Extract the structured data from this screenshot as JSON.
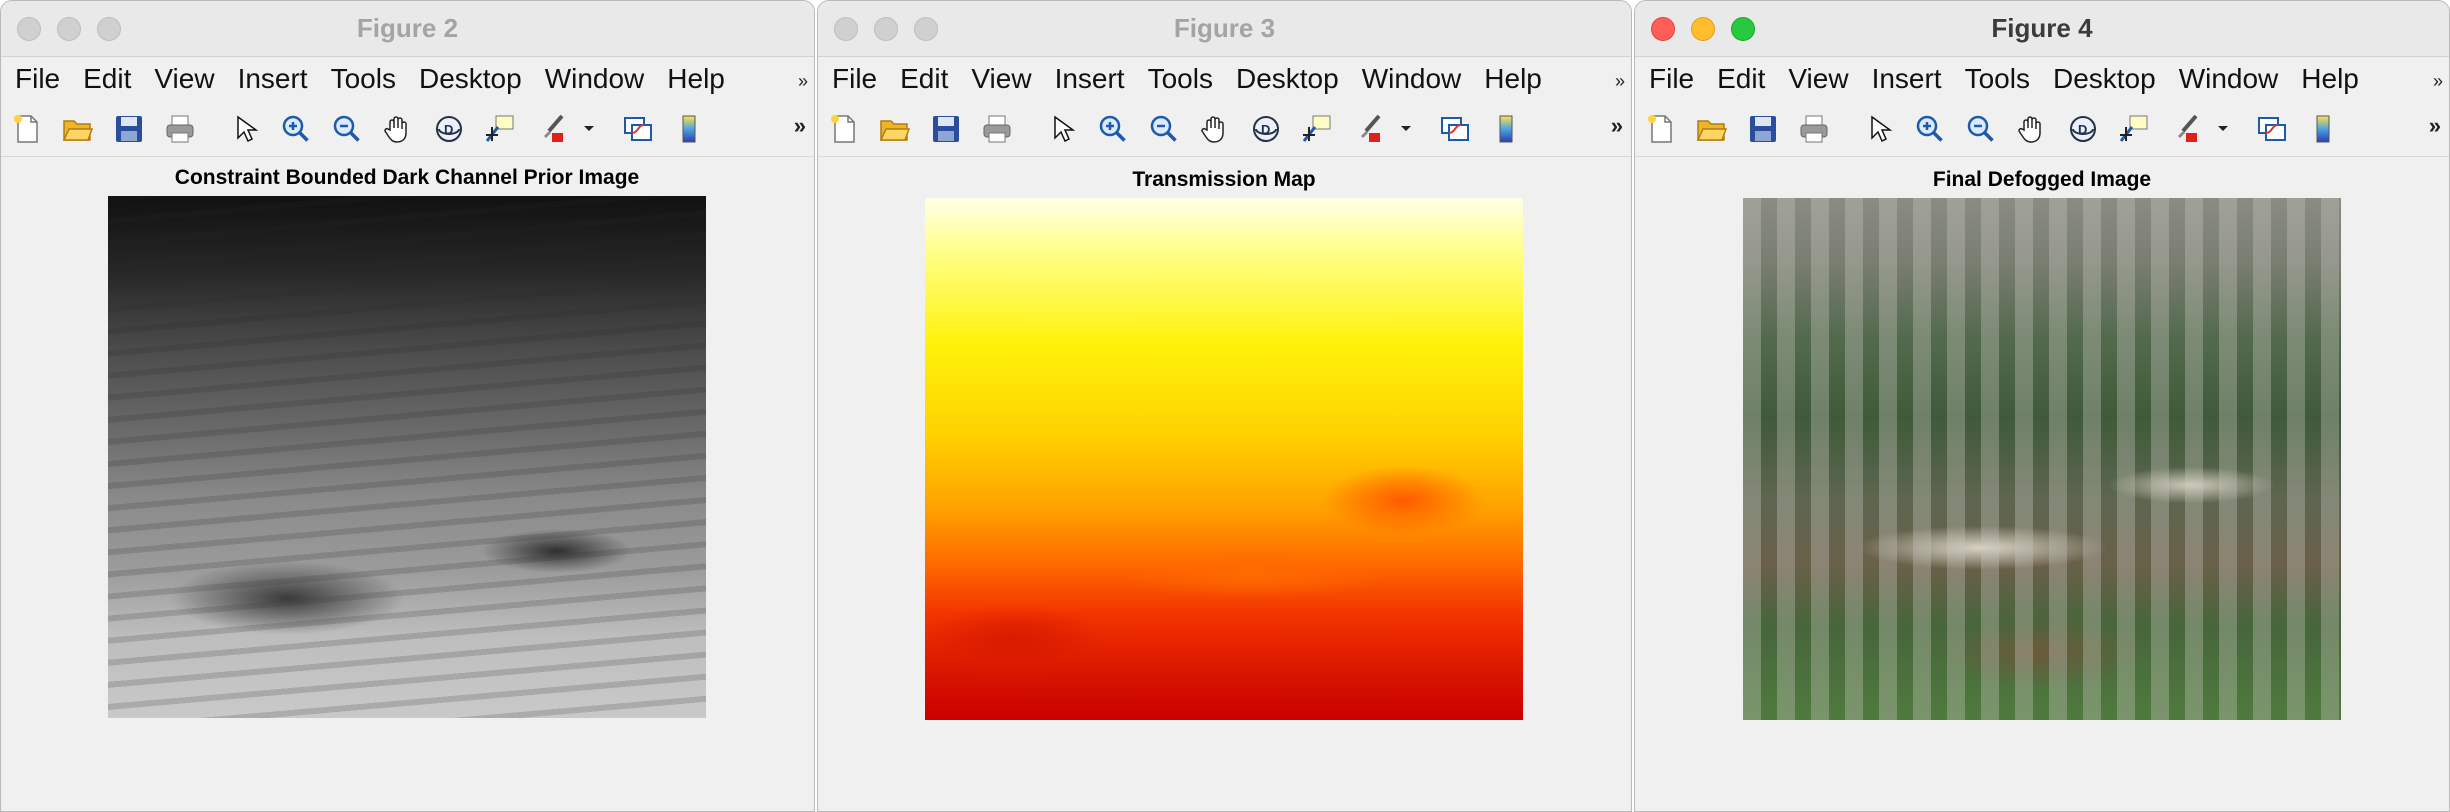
{
  "menu_labels": [
    "File",
    "Edit",
    "View",
    "Insert",
    "Tools",
    "Desktop",
    "Window",
    "Help"
  ],
  "toolbar_icons": [
    "new-figure-icon",
    "open-folder-icon",
    "save-icon",
    "print-icon",
    "pointer-icon",
    "zoom-in-icon",
    "zoom-out-icon",
    "pan-hand-icon",
    "rotate-3d-icon",
    "data-cursor-icon",
    "brush-icon",
    "link-plot-icon",
    "colorbar-icon"
  ],
  "overflow_menu_glyph": "»",
  "overflow_toolbar_glyph": "»",
  "windows": [
    {
      "title": "Figure 2",
      "active": false,
      "axes_title": "Constraint Bounded Dark Channel Prior Image",
      "colormap": "gray"
    },
    {
      "title": "Figure 3",
      "active": false,
      "axes_title": "Transmission Map",
      "colormap": "hot"
    },
    {
      "title": "Figure 4",
      "active": true,
      "axes_title": "Final Defogged Image",
      "colormap": "rgb"
    }
  ],
  "colors": {
    "traffic_red": "#ff5f57",
    "traffic_yellow": "#febc2e",
    "traffic_green": "#28c840",
    "window_bg": "#f0f0f0"
  }
}
